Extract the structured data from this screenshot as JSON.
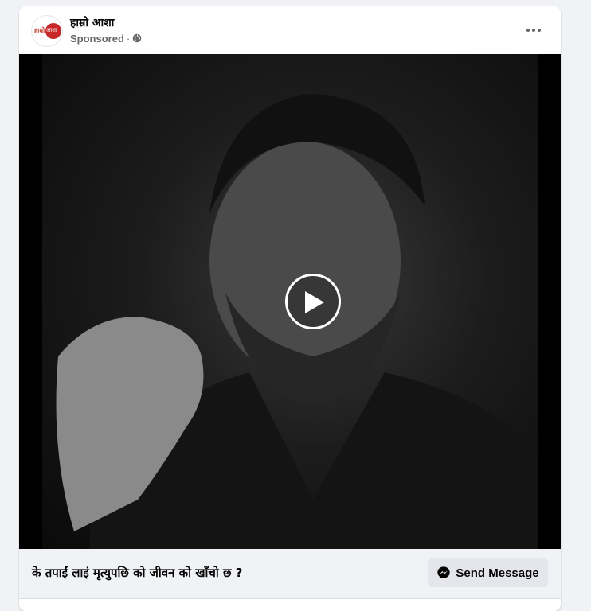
{
  "post": {
    "page_name": "हाम्रो आशा",
    "logo_text": "हाम्रो",
    "logo_badge": "आशा",
    "sponsored_label": "Sponsored",
    "separator": "·",
    "privacy_icon": "globe-icon",
    "menu_icon": "more-horizontal-icon"
  },
  "video": {
    "play_icon": "play-icon"
  },
  "footer": {
    "caption": "के तपाईं लाइं मृत्युपछि को जीवन को खाँचो छ ?",
    "cta_label": "Send Message",
    "cta_icon": "messenger-icon"
  },
  "colors": {
    "background": "#f0f2f5",
    "card": "#ffffff",
    "muted_text": "#65676b",
    "button_bg": "#e4e6eb",
    "logo_red": "#c62828"
  }
}
